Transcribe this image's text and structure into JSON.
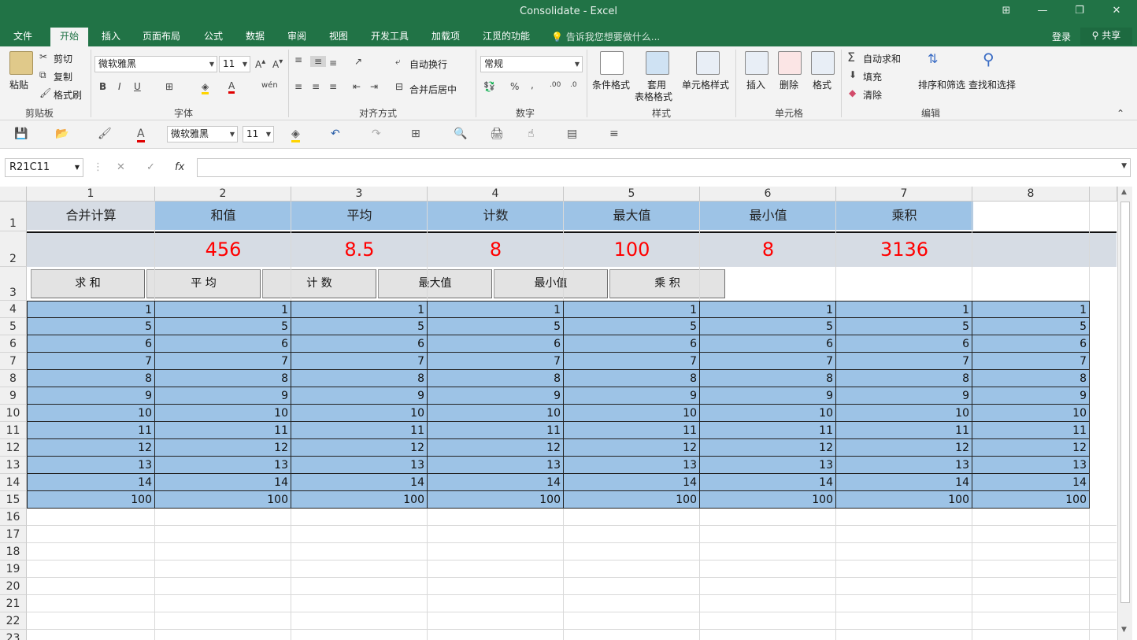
{
  "window": {
    "title": "Consolidate - Excel",
    "controls": [
      "⊞",
      "—",
      "❐",
      "✕"
    ]
  },
  "tabs": [
    "文件",
    "开始",
    "插入",
    "页面布局",
    "公式",
    "数据",
    "审阅",
    "视图",
    "开发工具",
    "加载项",
    "江觅的功能"
  ],
  "tell_me": "告诉我您想要做什么...",
  "login": "登录",
  "share": "共享",
  "ribbon": {
    "clipboard": {
      "paste": "粘贴",
      "cut": "剪切",
      "copy": "复制",
      "format_painter": "格式刷",
      "group": "剪贴板"
    },
    "font": {
      "name": "微软雅黑",
      "size": "11",
      "group": "字体"
    },
    "align": {
      "wrap": "自动换行",
      "merge": "合并后居中",
      "group": "对齐方式"
    },
    "number": {
      "format": "常规",
      "group": "数字"
    },
    "styles": {
      "cond": "条件格式",
      "table1": "套用",
      "table2": "表格格式",
      "cell": "单元格样式",
      "group": "样式"
    },
    "cells": {
      "insert": "插入",
      "delete": "删除",
      "format": "格式",
      "group": "单元格"
    },
    "editing": {
      "autosum": "自动求和",
      "fill": "填充",
      "clear": "清除",
      "sort": "排序和筛选",
      "find": "查找和选择",
      "group": "编辑"
    }
  },
  "qat": {
    "font": "微软雅黑",
    "size": "11"
  },
  "namebox": "R21C11",
  "sheet": {
    "col_headers": [
      "1",
      "2",
      "3",
      "4",
      "5",
      "6",
      "7",
      "8"
    ],
    "row_headers": [
      "1",
      "2",
      "3",
      "4",
      "5",
      "6",
      "7",
      "8",
      "9",
      "10",
      "11",
      "12",
      "13",
      "14",
      "15",
      "16",
      "17",
      "18",
      "19",
      "20",
      "21",
      "22",
      "23"
    ],
    "row1": [
      "合并计算",
      "和值",
      "平均",
      "计数",
      "最大值",
      "最小值",
      "乘积"
    ],
    "row2": [
      "456",
      "8.5",
      "8",
      "100",
      "8",
      "3136"
    ],
    "buttons": [
      "求 和",
      "平 均",
      "计 数",
      "最大值",
      "最小值",
      "乘 积"
    ],
    "data_rows": [
      "1",
      "5",
      "6",
      "7",
      "8",
      "9",
      "10",
      "11",
      "12",
      "13",
      "14",
      "100"
    ]
  },
  "colors": {
    "excel_green": "#217346",
    "header_blue": "#9dc3e6",
    "result_gray": "#d6dce4",
    "result_red": "#ff0000"
  }
}
